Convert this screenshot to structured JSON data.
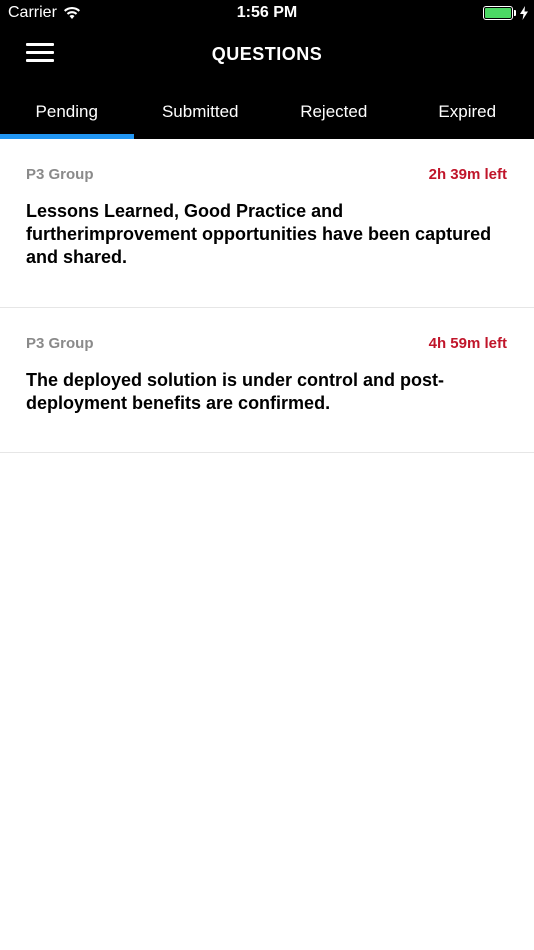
{
  "status_bar": {
    "carrier": "Carrier",
    "time": "1:56 PM",
    "battery_color": "#4cd964"
  },
  "nav": {
    "title": "QUESTIONS",
    "menu_icon": "hamburger-menu-icon"
  },
  "tabs": [
    {
      "label": "Pending",
      "active": true
    },
    {
      "label": "Submitted",
      "active": false
    },
    {
      "label": "Rejected",
      "active": false
    },
    {
      "label": "Expired",
      "active": false
    }
  ],
  "accent_color": "#2196f3",
  "questions": [
    {
      "group": "P3 Group",
      "time_left": "2h 39m left",
      "text": "Lessons Learned, Good Practice and furtherimprovement opportunities have been captured and shared."
    },
    {
      "group": "P3 Group",
      "time_left": "4h 59m left",
      "text": "The deployed solution is under control and post-deployment benefits are confirmed."
    }
  ]
}
